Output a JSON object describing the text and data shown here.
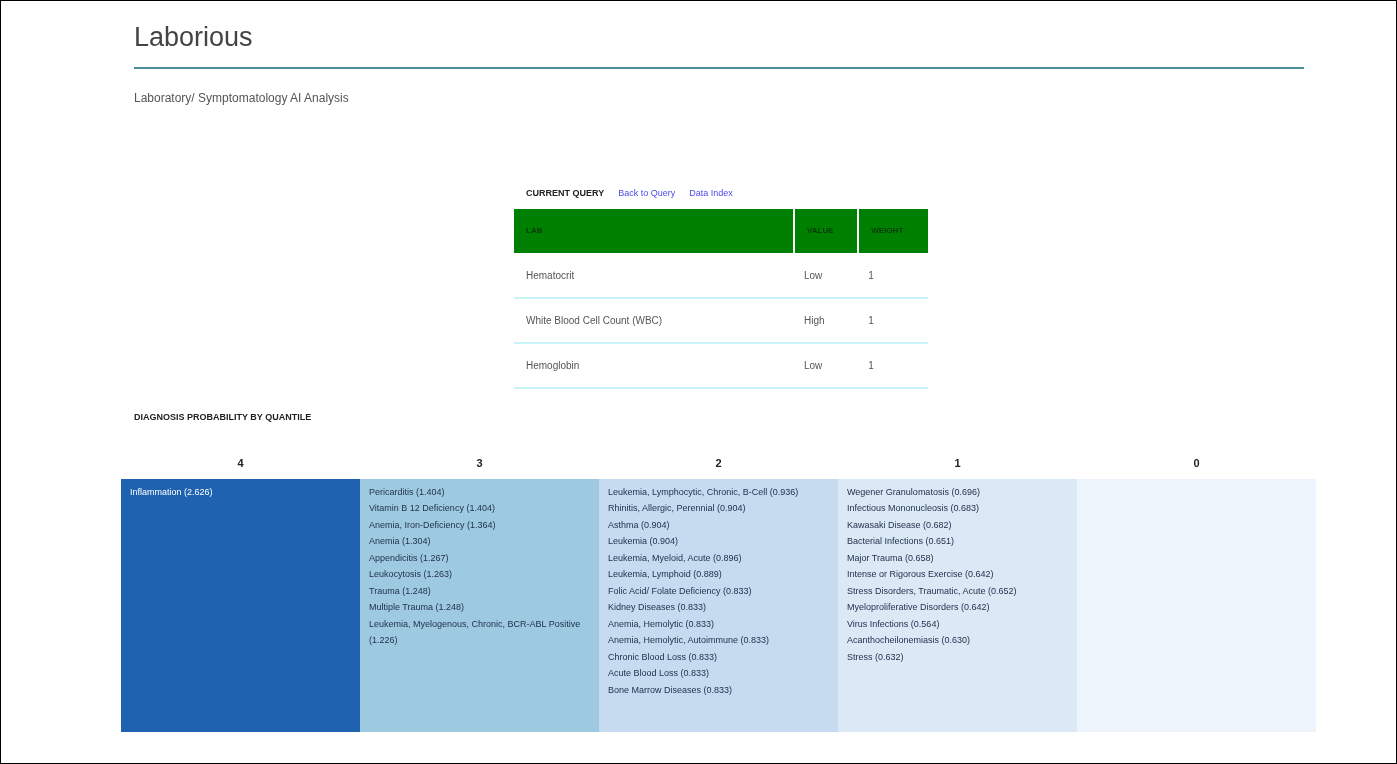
{
  "header": {
    "title": "Laborious",
    "subtitle": "Laboratory/ Symptomatology AI Analysis"
  },
  "query": {
    "title": "CURRENT QUERY",
    "links": [
      "Back to Query",
      "Data Index"
    ],
    "columns": [
      "LAB",
      "VALUE",
      "WEIGHT"
    ],
    "rows": [
      [
        "Hematocrit",
        "Low",
        "1"
      ],
      [
        "White Blood Cell Count (WBC)",
        "High",
        "1"
      ],
      [
        "Hemoglobin",
        "Low",
        "1"
      ]
    ]
  },
  "diagnosis": {
    "title": "DIAGNOSIS PROBABILITY BY QUANTILE",
    "quantiles": [
      {
        "label": "4",
        "color": "#1f63b0",
        "items": [
          "Inflammation (2.626)"
        ]
      },
      {
        "label": "3",
        "color": "#9ecae1",
        "items": [
          "Pericarditis (1.404)",
          "Vitamin B 12 Deficiency (1.404)",
          "Anemia, Iron-Deficiency (1.364)",
          "Anemia (1.304)",
          "Appendicitis (1.267)",
          "Leukocytosis (1.263)",
          "Trauma (1.248)",
          "Multiple Trauma (1.248)",
          "Leukemia, Myelogenous, Chronic, BCR-ABL Positive (1.226)"
        ]
      },
      {
        "label": "2",
        "color": "#c6dbef",
        "items": [
          "Leukemia, Lymphocytic, Chronic, B-Cell (0.936)",
          "Rhinitis, Allergic, Perennial (0.904)",
          "Asthma (0.904)",
          "Leukemia (0.904)",
          "Leukemia, Myeloid, Acute (0.896)",
          "Leukemia, Lymphoid (0.889)",
          "Folic Acid/ Folate Deficiency (0.833)",
          "Kidney Diseases (0.833)",
          "Anemia, Hemolytic (0.833)",
          "Anemia, Hemolytic, Autoimmune (0.833)",
          "Chronic Blood Loss (0.833)",
          "Acute Blood Loss (0.833)",
          "Bone Marrow Diseases (0.833)"
        ]
      },
      {
        "label": "1",
        "color": "#dbe8f5",
        "items": [
          "Wegener Granulomatosis (0.696)",
          "Infectious Mononucleosis (0.683)",
          "Kawasaki Disease (0.682)",
          "Bacterial Infections (0.651)",
          "Major Trauma (0.658)",
          "Intense or Rigorous Exercise (0.642)",
          "Stress Disorders, Traumatic, Acute (0.652)",
          "Myeloproliferative Disorders (0.642)",
          "Virus Infections (0.564)",
          "Acanthocheilonemiasis (0.630)",
          "Stress (0.632)"
        ]
      },
      {
        "label": "0",
        "color": "#eef4fb"
      }
    ]
  }
}
